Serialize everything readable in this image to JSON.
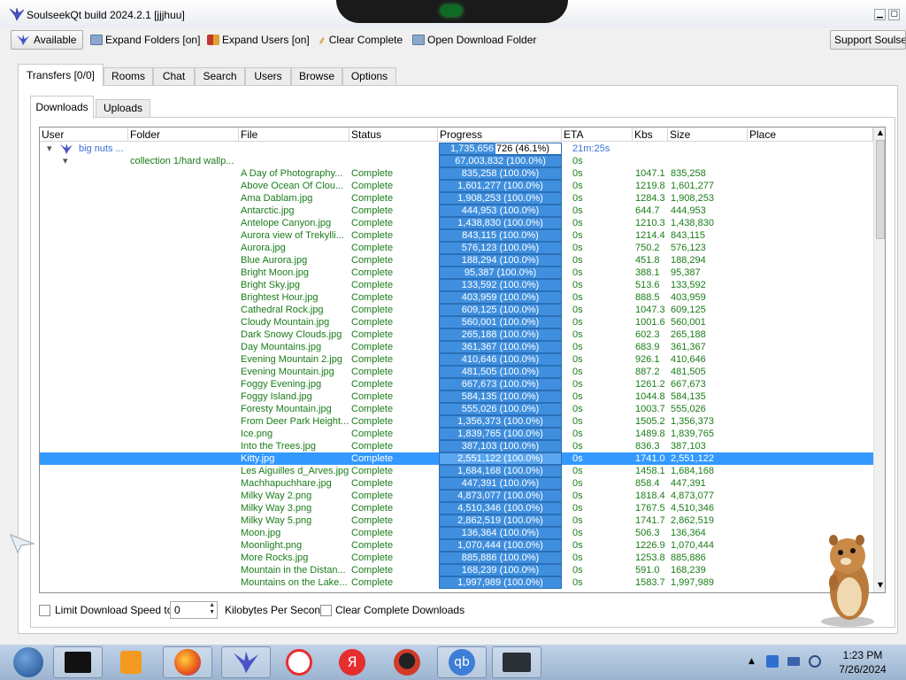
{
  "window": {
    "title": "SoulseekQt build 2024.2.1 [jjjhuu]"
  },
  "toolbar": {
    "available": "Available",
    "expand_folders": "Expand Folders [on]",
    "expand_users": "Expand Users [on]",
    "clear_complete": "Clear Complete",
    "open_download_folder": "Open Download Folder",
    "support": "Support Soulseek"
  },
  "main_tabs": [
    "Transfers [0/0]",
    "Rooms",
    "Chat",
    "Search",
    "Users",
    "Browse",
    "Options"
  ],
  "sub_tabs": [
    "Downloads",
    "Uploads"
  ],
  "columns": [
    "User",
    "Folder",
    "File",
    "Status",
    "Progress",
    "ETA",
    "Kbs",
    "Size",
    "Place"
  ],
  "user_row": {
    "user": "big nuts ...",
    "progress_done": "1,735,656",
    "progress_rest": "726 (46.1%)",
    "progress_fraction": 0.461,
    "eta": "21m:25s"
  },
  "folder_row": {
    "folder": "collection 1/hard wallp...",
    "progress": "67,003,832 (100.0%)",
    "eta": "0s"
  },
  "files": [
    {
      "file": "A Day of Photography...",
      "status": "Complete",
      "progress": "835,258 (100.0%)",
      "eta": "0s",
      "kbs": "1047.1",
      "size": "835,258"
    },
    {
      "file": "Above Ocean Of Clou...",
      "status": "Complete",
      "progress": "1,601,277 (100.0%)",
      "eta": "0s",
      "kbs": "1219.8",
      "size": "1,601,277"
    },
    {
      "file": "Ama Dablam.jpg",
      "status": "Complete",
      "progress": "1,908,253 (100.0%)",
      "eta": "0s",
      "kbs": "1284.3",
      "size": "1,908,253"
    },
    {
      "file": "Antarctic.jpg",
      "status": "Complete",
      "progress": "444,953 (100.0%)",
      "eta": "0s",
      "kbs": "644.7",
      "size": "444,953"
    },
    {
      "file": "Antelope Canyon.jpg",
      "status": "Complete",
      "progress": "1,438,830 (100.0%)",
      "eta": "0s",
      "kbs": "1210.3",
      "size": "1,438,830"
    },
    {
      "file": "Aurora view of Trekylli...",
      "status": "Complete",
      "progress": "843,115 (100.0%)",
      "eta": "0s",
      "kbs": "1214.4",
      "size": "843,115"
    },
    {
      "file": "Aurora.jpg",
      "status": "Complete",
      "progress": "576,123 (100.0%)",
      "eta": "0s",
      "kbs": "750.2",
      "size": "576,123"
    },
    {
      "file": "Blue Aurora.jpg",
      "status": "Complete",
      "progress": "188,294 (100.0%)",
      "eta": "0s",
      "kbs": "451.8",
      "size": "188,294"
    },
    {
      "file": "Bright Moon.jpg",
      "status": "Complete",
      "progress": "95,387 (100.0%)",
      "eta": "0s",
      "kbs": "388.1",
      "size": "95,387"
    },
    {
      "file": "Bright Sky.jpg",
      "status": "Complete",
      "progress": "133,592 (100.0%)",
      "eta": "0s",
      "kbs": "513.6",
      "size": "133,592"
    },
    {
      "file": "Brightest Hour.jpg",
      "status": "Complete",
      "progress": "403,959 (100.0%)",
      "eta": "0s",
      "kbs": "888.5",
      "size": "403,959"
    },
    {
      "file": "Cathedral Rock.jpg",
      "status": "Complete",
      "progress": "609,125 (100.0%)",
      "eta": "0s",
      "kbs": "1047.3",
      "size": "609,125"
    },
    {
      "file": "Cloudy Mountain.jpg",
      "status": "Complete",
      "progress": "560,001 (100.0%)",
      "eta": "0s",
      "kbs": "1001.6",
      "size": "560,001"
    },
    {
      "file": "Dark Snowy Clouds.jpg",
      "status": "Complete",
      "progress": "265,188 (100.0%)",
      "eta": "0s",
      "kbs": "602.3",
      "size": "265,188"
    },
    {
      "file": "Day Mountains.jpg",
      "status": "Complete",
      "progress": "361,367 (100.0%)",
      "eta": "0s",
      "kbs": "683.9",
      "size": "361,367"
    },
    {
      "file": "Evening Mountain 2.jpg",
      "status": "Complete",
      "progress": "410,646 (100.0%)",
      "eta": "0s",
      "kbs": "926.1",
      "size": "410,646"
    },
    {
      "file": "Evening Mountain.jpg",
      "status": "Complete",
      "progress": "481,505 (100.0%)",
      "eta": "0s",
      "kbs": "887.2",
      "size": "481,505"
    },
    {
      "file": "Foggy Evening.jpg",
      "status": "Complete",
      "progress": "667,673 (100.0%)",
      "eta": "0s",
      "kbs": "1261.2",
      "size": "667,673"
    },
    {
      "file": "Foggy Island.jpg",
      "status": "Complete",
      "progress": "584,135 (100.0%)",
      "eta": "0s",
      "kbs": "1044.8",
      "size": "584,135"
    },
    {
      "file": "Foresty Mountain.jpg",
      "status": "Complete",
      "progress": "555,026 (100.0%)",
      "eta": "0s",
      "kbs": "1003.7",
      "size": "555,026"
    },
    {
      "file": "From Deer Park Height...",
      "status": "Complete",
      "progress": "1,356,373 (100.0%)",
      "eta": "0s",
      "kbs": "1505.2",
      "size": "1,356,373"
    },
    {
      "file": "Ice.png",
      "status": "Complete",
      "progress": "1,839,765 (100.0%)",
      "eta": "0s",
      "kbs": "1489.8",
      "size": "1,839,765"
    },
    {
      "file": "Into the Trees.jpg",
      "status": "Complete",
      "progress": "387,103 (100.0%)",
      "eta": "0s",
      "kbs": "836.3",
      "size": "387,103"
    },
    {
      "file": "Kitty.jpg",
      "status": "Complete",
      "progress": "2,551,122 (100.0%)",
      "eta": "0s",
      "kbs": "1741.0",
      "size": "2,551,122",
      "selected": true
    },
    {
      "file": "Les Aiguilles d_Arves.jpg",
      "status": "Complete",
      "progress": "1,684,168 (100.0%)",
      "eta": "0s",
      "kbs": "1458.1",
      "size": "1,684,168"
    },
    {
      "file": "Machhapuchhare.jpg",
      "status": "Complete",
      "progress": "447,391 (100.0%)",
      "eta": "0s",
      "kbs": "858.4",
      "size": "447,391"
    },
    {
      "file": "Milky Way 2.png",
      "status": "Complete",
      "progress": "4,873,077 (100.0%)",
      "eta": "0s",
      "kbs": "1818.4",
      "size": "4,873,077"
    },
    {
      "file": "Milky Way 3.png",
      "status": "Complete",
      "progress": "4,510,346 (100.0%)",
      "eta": "0s",
      "kbs": "1767.5",
      "size": "4,510,346"
    },
    {
      "file": "Milky Way 5.png",
      "status": "Complete",
      "progress": "2,862,519 (100.0%)",
      "eta": "0s",
      "kbs": "1741.7",
      "size": "2,862,519"
    },
    {
      "file": "Moon.jpg",
      "status": "Complete",
      "progress": "136,364 (100.0%)",
      "eta": "0s",
      "kbs": "506.3",
      "size": "136,364"
    },
    {
      "file": "Moonlight.png",
      "status": "Complete",
      "progress": "1,070,444 (100.0%)",
      "eta": "0s",
      "kbs": "1226.9",
      "size": "1,070,444"
    },
    {
      "file": "More Rocks.jpg",
      "status": "Complete",
      "progress": "885,886 (100.0%)",
      "eta": "0s",
      "kbs": "1253.8",
      "size": "885,886"
    },
    {
      "file": "Mountain in the Distan...",
      "status": "Complete",
      "progress": "168,239 (100.0%)",
      "eta": "0s",
      "kbs": "591.0",
      "size": "168,239"
    },
    {
      "file": "Mountains on the Lake...",
      "status": "Complete",
      "progress": "1,997,989 (100.0%)",
      "eta": "0s",
      "kbs": "1583.7",
      "size": "1,997,989"
    }
  ],
  "bottom": {
    "limit_label": "Limit Download Speed to",
    "speed_value": "0",
    "unit_label": "Kilobytes Per Second",
    "clear_label": "Clear Complete Downloads"
  },
  "taskbar": {
    "time": "1:23 PM",
    "date": "7/26/2024"
  },
  "colors": {
    "selected_row": "#3399ff",
    "progress_fill": "#3f8fde",
    "complete_text": "#1a7c1a",
    "user_text": "#3b6fd6"
  }
}
